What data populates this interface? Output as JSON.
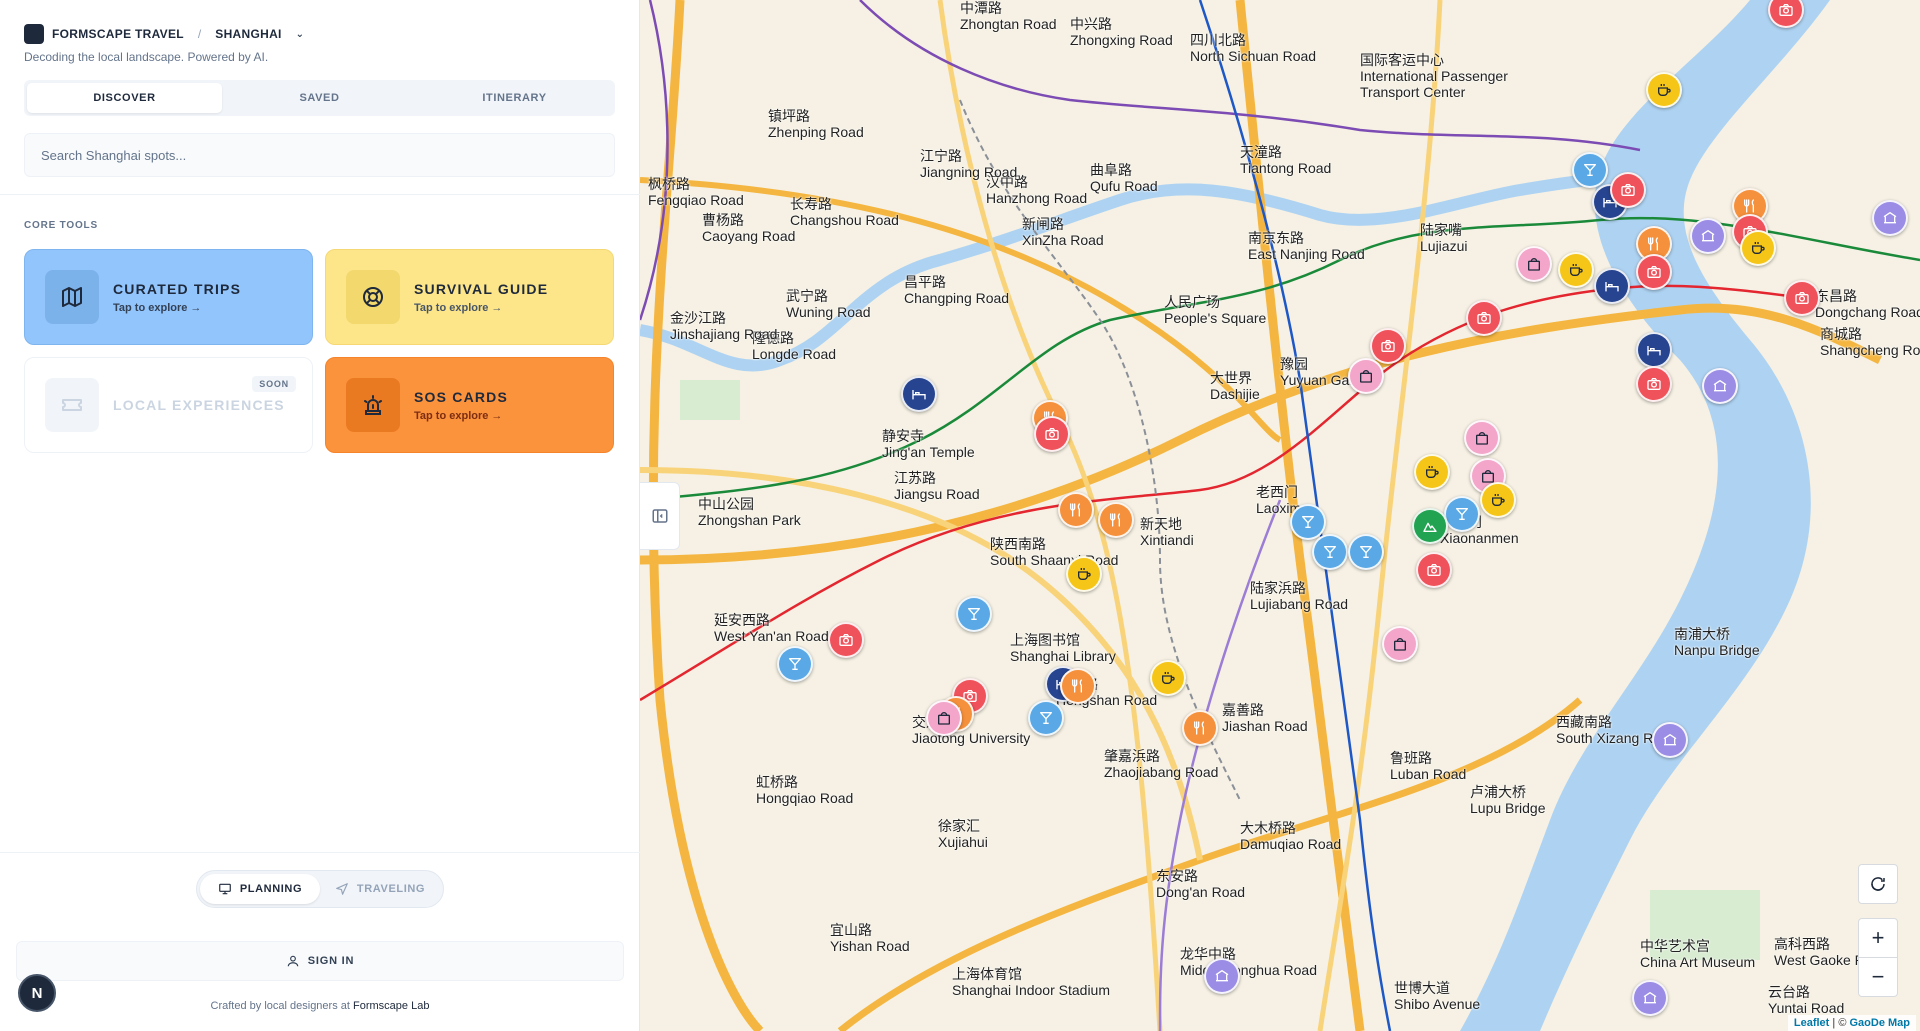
{
  "header": {
    "brand": "FORMSCAPE TRAVEL",
    "separator": "/",
    "city": "SHANGHAI",
    "tagline": "Decoding the local landscape. Powered by AI."
  },
  "tabs": [
    {
      "label": "DISCOVER",
      "active": true
    },
    {
      "label": "SAVED",
      "active": false
    },
    {
      "label": "ITINERARY",
      "active": false
    }
  ],
  "search": {
    "placeholder": "Search Shanghai spots..."
  },
  "core_tools": {
    "label": "CORE TOOLS",
    "cards": [
      {
        "title": "CURATED TRIPS",
        "sub": "Tap to explore →",
        "icon": "map-icon"
      },
      {
        "title": "SURVIVAL GUIDE",
        "sub": "Tap to explore →",
        "icon": "lifebuoy-icon"
      },
      {
        "title": "LOCAL EXPERIENCES",
        "badge": "SOON",
        "icon": "ticket-icon"
      },
      {
        "title": "SOS CARDS",
        "sub": "Tap to explore →",
        "icon": "siren-icon"
      }
    ]
  },
  "mode": {
    "planning": "PLANNING",
    "traveling": "TRAVELING",
    "active": "planning"
  },
  "footer": {
    "sign_in": "SIGN IN",
    "credit_prefix": "Crafted by local designers at",
    "credit_lab": "Formscape Lab",
    "avatar_letter": "N"
  },
  "map": {
    "colors": {
      "photo": "#f0525c",
      "food": "#f5903c",
      "cafe": "#f5c518",
      "bar": "#5aa9e6",
      "shop": "#f3a6c9",
      "hotel": "#26448f",
      "landmark": "#9b8ce6",
      "park": "#22a352"
    },
    "labels": [
      {
        "cn": "中兴路",
        "en": "Zhongxing Road"
      },
      {
        "cn": "四川北路",
        "en": "North Sichuan Road"
      },
      {
        "cn": "国际客运中心",
        "en": "International Passenger Transport Center"
      },
      {
        "cn": "天潼路",
        "en": "Tiantong Road"
      },
      {
        "cn": "曲阜路",
        "en": "Qufu Road"
      },
      {
        "cn": "新闸路",
        "en": "XinZha Road"
      },
      {
        "cn": "汉中路",
        "en": "Hanzhong Road"
      },
      {
        "cn": "人民广场",
        "en": "People's Square"
      },
      {
        "cn": "南京东路",
        "en": "East Nanjing Road"
      },
      {
        "cn": "陆家嘴",
        "en": "Lujiazui"
      },
      {
        "cn": "东昌路",
        "en": "Dongchang Road"
      },
      {
        "cn": "大世界",
        "en": "Dashijie"
      },
      {
        "cn": "豫园",
        "en": "Yuyuan Garden"
      },
      {
        "cn": "老西门",
        "en": "Laoximen"
      },
      {
        "cn": "陕西南路",
        "en": "South Shaanxi Road"
      },
      {
        "cn": "新天地",
        "en": "Xintiandi"
      },
      {
        "cn": "小南门",
        "en": "Xiaonanmen"
      },
      {
        "cn": "陆家浜路",
        "en": "Lujiabang Road"
      },
      {
        "cn": "南浦大桥",
        "en": "Nanpu Bridge"
      },
      {
        "cn": "静安寺",
        "en": "Jing'an Temple"
      },
      {
        "cn": "江苏路",
        "en": "Jiangsu Road"
      },
      {
        "cn": "中山公园",
        "en": "Zhongshan Park"
      },
      {
        "cn": "延安西路",
        "en": "West Yan'an Road"
      },
      {
        "cn": "上海图书馆",
        "en": "Shanghai Library"
      },
      {
        "cn": "衡山路",
        "en": "Hengshan Road"
      },
      {
        "cn": "交通大学",
        "en": "Jiaotong University"
      },
      {
        "cn": "嘉善路",
        "en": "Jiashan Road"
      },
      {
        "cn": "肇嘉浜路",
        "en": "Zhaojiabang Road"
      },
      {
        "cn": "西藏南路",
        "en": "South Xizang Road"
      },
      {
        "cn": "鲁班路",
        "en": "Luban Road"
      },
      {
        "cn": "卢浦大桥",
        "en": "Lupu Bridge"
      },
      {
        "cn": "大木桥路",
        "en": "Damuqiao Road"
      },
      {
        "cn": "东安路",
        "en": "Dong'an Road"
      },
      {
        "cn": "徐家汇",
        "en": "Xujiahui"
      },
      {
        "cn": "虹桥路",
        "en": "Hongqiao Road"
      },
      {
        "cn": "宜山路",
        "en": "Yishan Road"
      },
      {
        "cn": "龙华中路",
        "en": "Middle Longhua Road"
      },
      {
        "cn": "上海体育馆",
        "en": "Shanghai Indoor Stadium"
      },
      {
        "cn": "中华艺术宫",
        "en": "China Art Museum"
      },
      {
        "cn": "世博大道",
        "en": "Shibo Avenue"
      },
      {
        "cn": "高科西路",
        "en": "West Gaoke Road"
      },
      {
        "cn": "云台路",
        "en": "Yuntai Road"
      },
      {
        "cn": "镇坪路",
        "en": "Zhenping Road"
      },
      {
        "cn": "长寿路",
        "en": "Changshou Road"
      },
      {
        "cn": "江宁路",
        "en": "Jiangning Road"
      },
      {
        "cn": "昌平路",
        "en": "Changping Road"
      },
      {
        "cn": "武宁路",
        "en": "Wuning Road"
      },
      {
        "cn": "隆德路",
        "en": "Longde Road"
      },
      {
        "cn": "金沙江路",
        "en": "Jinshajiang Road"
      },
      {
        "cn": "曹杨路",
        "en": "Caoyang Road"
      },
      {
        "cn": "枫桥路",
        "en": "Fengqiao Road"
      },
      {
        "cn": "中潭路",
        "en": "Zhongtan Road"
      },
      {
        "cn": "商城路",
        "en": "Shangcheng Road"
      }
    ],
    "controls": {
      "zoom_in": "+",
      "zoom_out": "−"
    },
    "attribution": {
      "leaflet": "Leaflet",
      "sep": " | © ",
      "provider": "GaoDe Map"
    }
  }
}
